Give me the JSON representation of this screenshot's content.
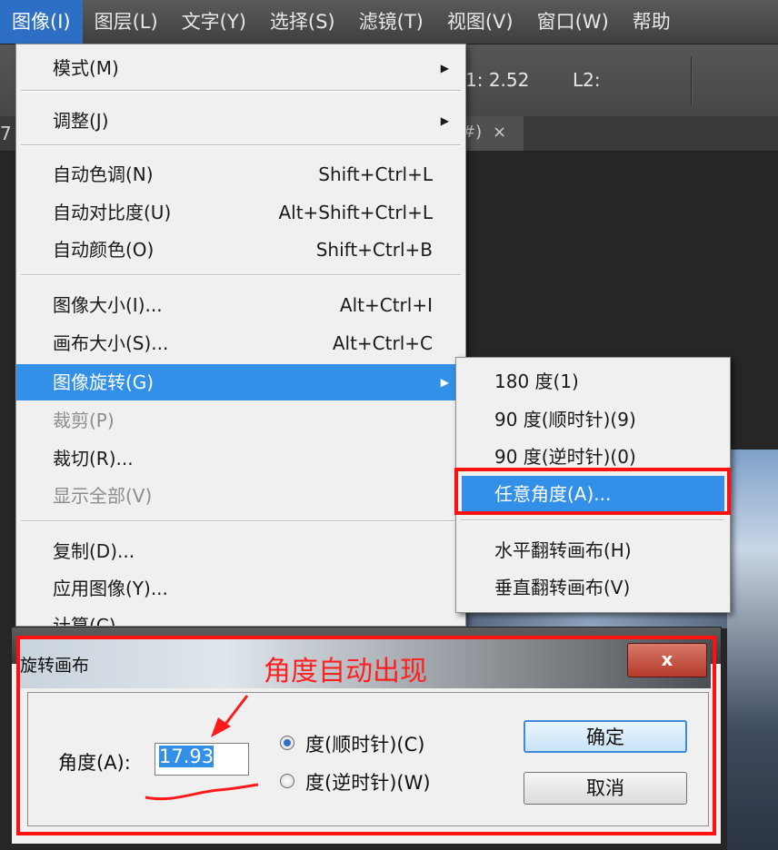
{
  "menubar": {
    "items": [
      "图像(I)",
      "图层(L)",
      "文字(Y)",
      "选择(S)",
      "滤镜(T)",
      "视图(V)",
      "窗口(W)",
      "帮助"
    ]
  },
  "optbar": {
    "l1": "1:  2.52",
    "l2": "L2:"
  },
  "tabstrip": {
    "left_digit": "7",
    "tab_suffix": "#)",
    "close": "×"
  },
  "image_menu": {
    "items": [
      {
        "label": "模式(M)",
        "shortcut": "",
        "submenu": true
      },
      {
        "label": "调整(J)",
        "shortcut": "",
        "submenu": true
      },
      {
        "label": "自动色调(N)",
        "shortcut": "Shift+Ctrl+L"
      },
      {
        "label": "自动对比度(U)",
        "shortcut": "Alt+Shift+Ctrl+L"
      },
      {
        "label": "自动颜色(O)",
        "shortcut": "Shift+Ctrl+B"
      },
      {
        "label": "图像大小(I)...",
        "shortcut": "Alt+Ctrl+I"
      },
      {
        "label": "画布大小(S)...",
        "shortcut": "Alt+Ctrl+C"
      },
      {
        "label": "图像旋转(G)",
        "shortcut": "",
        "submenu": true
      },
      {
        "label": "裁剪(P)",
        "shortcut": "",
        "disabled": true
      },
      {
        "label": "裁切(R)...",
        "shortcut": ""
      },
      {
        "label": "显示全部(V)",
        "shortcut": "",
        "disabled": true
      },
      {
        "label": "复制(D)...",
        "shortcut": ""
      },
      {
        "label": "应用图像(Y)...",
        "shortcut": ""
      },
      {
        "label": "计算(C)...",
        "shortcut": ""
      }
    ]
  },
  "rotation_submenu": {
    "items": [
      "180 度(1)",
      "90 度(顺时针)(9)",
      "90 度(逆时针)(0)",
      "任意角度(A)...",
      "水平翻转画布(H)",
      "垂直翻转画布(V)"
    ]
  },
  "dialog": {
    "title": "旋转画布",
    "close": "x",
    "annotation": "角度自动出现",
    "angle_label": "角度(A):",
    "angle_value": "17.93",
    "cw_label": "度(顺时针)(C)",
    "ccw_label": "度(逆时针)(W)",
    "ok": "确定",
    "cancel": "取消"
  },
  "colors": {
    "highlight": "#3390e8",
    "annotation_red": "#ff1010"
  }
}
